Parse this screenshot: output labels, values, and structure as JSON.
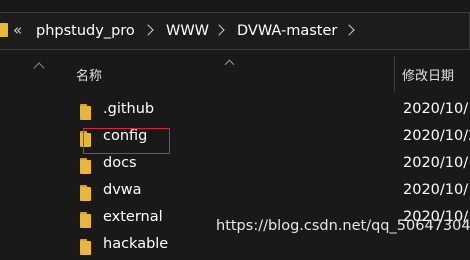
{
  "breadcrumb": {
    "overflow_glyph": "«",
    "items": [
      {
        "label": "phpstudy_pro"
      },
      {
        "label": "WWW"
      },
      {
        "label": "DVWA-master"
      }
    ]
  },
  "columns": {
    "name": "名称",
    "modified": "修改日期"
  },
  "files": [
    {
      "name": ".github",
      "modified": "2020/10/"
    },
    {
      "name": "config",
      "modified": "2020/10/2"
    },
    {
      "name": "docs",
      "modified": "2020/10/"
    },
    {
      "name": "dvwa",
      "modified": "2020/10/"
    },
    {
      "name": "external",
      "modified": "2020/10/"
    },
    {
      "name": "hackable",
      "modified": ""
    }
  ],
  "highlighted_item": "config",
  "watermark": "https://blog.csdn.net/qq_50647304",
  "colors": {
    "background": "#191919",
    "folder": "#e8b63a",
    "highlight": "#d22b2b",
    "text": "#ffffff"
  }
}
